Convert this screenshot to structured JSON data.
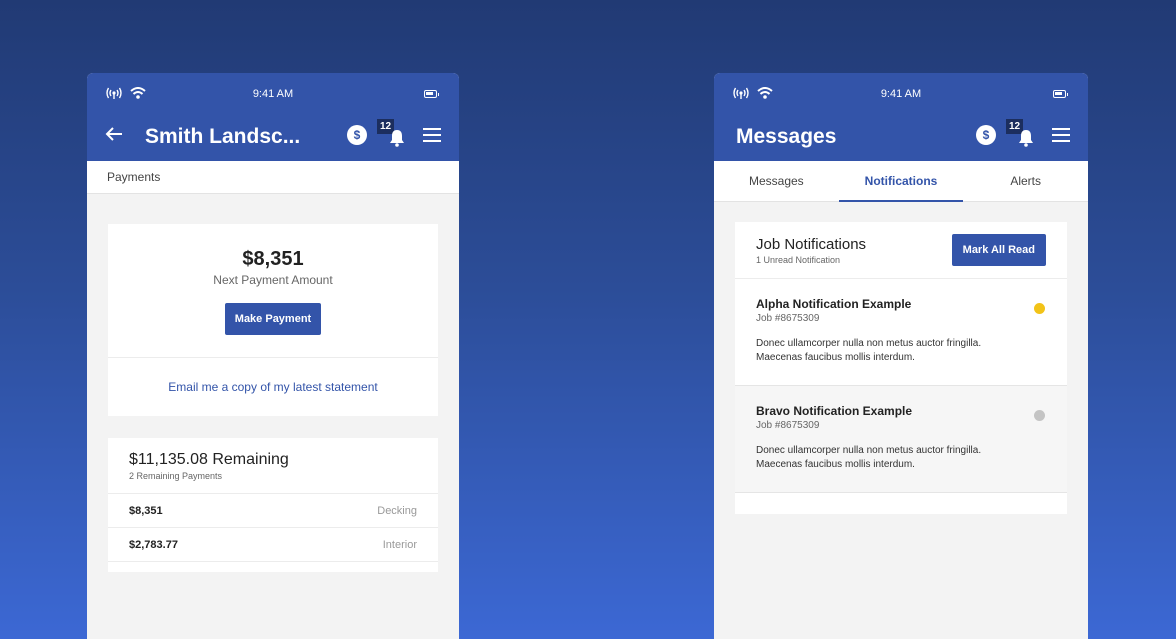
{
  "status": {
    "time": "9:41 AM"
  },
  "left": {
    "title": "Smith Landsc...",
    "badge_count": "12",
    "coin_glyph": "$",
    "breadcrumb": "Payments",
    "payment": {
      "amount": "$8,351",
      "label": "Next Payment Amount",
      "button": "Make Payment",
      "email_link": "Email me a copy of my latest statement"
    },
    "remaining": {
      "title": "$11,135.08 Remaining",
      "subtitle": "2 Remaining Payments",
      "rows": [
        {
          "amount": "$8,351",
          "category": "Decking"
        },
        {
          "amount": "$2,783.77",
          "category": "Interior"
        }
      ]
    }
  },
  "right": {
    "title": "Messages",
    "badge_count": "12",
    "coin_glyph": "$",
    "tabs": [
      {
        "label": "Messages",
        "active": false
      },
      {
        "label": "Notifications",
        "active": true
      },
      {
        "label": "Alerts",
        "active": false
      }
    ],
    "card": {
      "title": "Job Notifications",
      "subtitle": "1 Unread Notification",
      "button": "Mark All Read"
    },
    "notifications": [
      {
        "title": "Alpha Notification Example",
        "job": "Job #8675309",
        "body": "Donec ullamcorper nulla non metus auctor fringilla. Maecenas faucibus mollis interdum.",
        "unread": true,
        "dot_color": "#f2c318"
      },
      {
        "title": "Bravo Notification Example",
        "job": "Job #8675309",
        "body": "Donec ullamcorper nulla non metus auctor fringilla. Maecenas faucibus mollis interdum.",
        "unread": false,
        "dot_color": "#c4c4c4"
      }
    ]
  },
  "colors": {
    "primary": "#3354a9",
    "badge_bg": "#1c2e5e"
  }
}
